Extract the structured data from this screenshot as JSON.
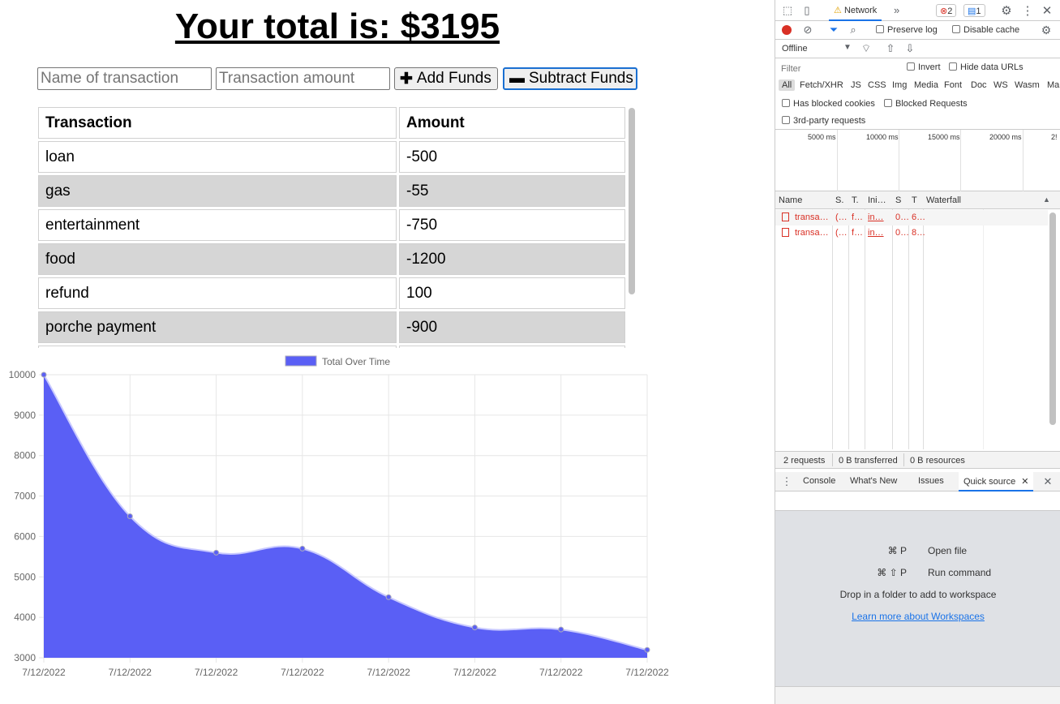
{
  "app": {
    "title": "Your total is: $3195",
    "name_placeholder": "Name of transaction",
    "amount_placeholder": "Transaction amount",
    "add_label": "Add Funds",
    "subtract_label": "Subtract Funds",
    "table": {
      "headers": [
        "Transaction",
        "Amount"
      ],
      "rows": [
        [
          "loan",
          "-500"
        ],
        [
          "gas",
          "-55"
        ],
        [
          "entertainment",
          "-750"
        ],
        [
          "food",
          "-1200"
        ],
        [
          "refund",
          "100"
        ],
        [
          "porche payment",
          "-900"
        ]
      ]
    }
  },
  "chart_data": {
    "type": "area",
    "legend": "Total Over Time",
    "x": [
      "7/12/2022",
      "7/12/2022",
      "7/12/2022",
      "7/12/2022",
      "7/12/2022",
      "7/12/2022",
      "7/12/2022",
      "7/12/2022"
    ],
    "series": [
      {
        "name": "Total Over Time",
        "values": [
          10000,
          6500,
          5600,
          5700,
          4500,
          3750,
          3700,
          3195
        ]
      }
    ],
    "ylim": [
      3000,
      10000
    ],
    "yticks": [
      "10000",
      "9000",
      "8000",
      "7000",
      "6000",
      "5000",
      "4000",
      "3000"
    ],
    "grid": true,
    "legend_position": "top",
    "fill_color": "#5a5ff5",
    "line_color": "#5a5ff5"
  },
  "devtools": {
    "tabs": [
      "Network"
    ],
    "more_tabs": "»",
    "errors_count": "2",
    "messages_count": "1",
    "preserve_log": "Preserve log",
    "disable_cache": "Disable cache",
    "throttle": "Offline",
    "filter_placeholder": "Filter",
    "invert": "Invert",
    "hide_data_urls": "Hide data URLs",
    "type_filters": [
      "All",
      "Fetch/XHR",
      "JS",
      "CSS",
      "Img",
      "Media",
      "Font",
      "Doc",
      "WS",
      "Wasm",
      "Ma"
    ],
    "has_blocked_cookies": "Has blocked cookies",
    "blocked_requests": "Blocked Requests",
    "third_party": "3rd-party requests",
    "timeline_ticks": [
      "5000 ms",
      "10000 ms",
      "15000 ms",
      "20000 ms",
      "2!"
    ],
    "columns": [
      "Name",
      "S.",
      "T.",
      "Ini…",
      "S",
      "T",
      "Waterfall"
    ],
    "requests": [
      [
        "transa…",
        "(…",
        "f…",
        "in…",
        "0…",
        "6…"
      ],
      [
        "transa…",
        "(…",
        "f…",
        "in…",
        "0…",
        "8…"
      ]
    ],
    "summary": [
      "2 requests",
      "0 B transferred",
      "0 B resources"
    ],
    "drawer_tabs": [
      "Console",
      "What's New",
      "Issues",
      "Quick source"
    ],
    "shortcuts": [
      {
        "keys": "⌘ P",
        "label": "Open file"
      },
      {
        "keys": "⌘ ⇧ P",
        "label": "Run command"
      }
    ],
    "drop_text": "Drop in a folder to add to workspace",
    "learn_more": "Learn more about Workspaces",
    "colors": {
      "accent": "#1a73e8",
      "error": "#d93025",
      "record": "#d93025"
    }
  }
}
